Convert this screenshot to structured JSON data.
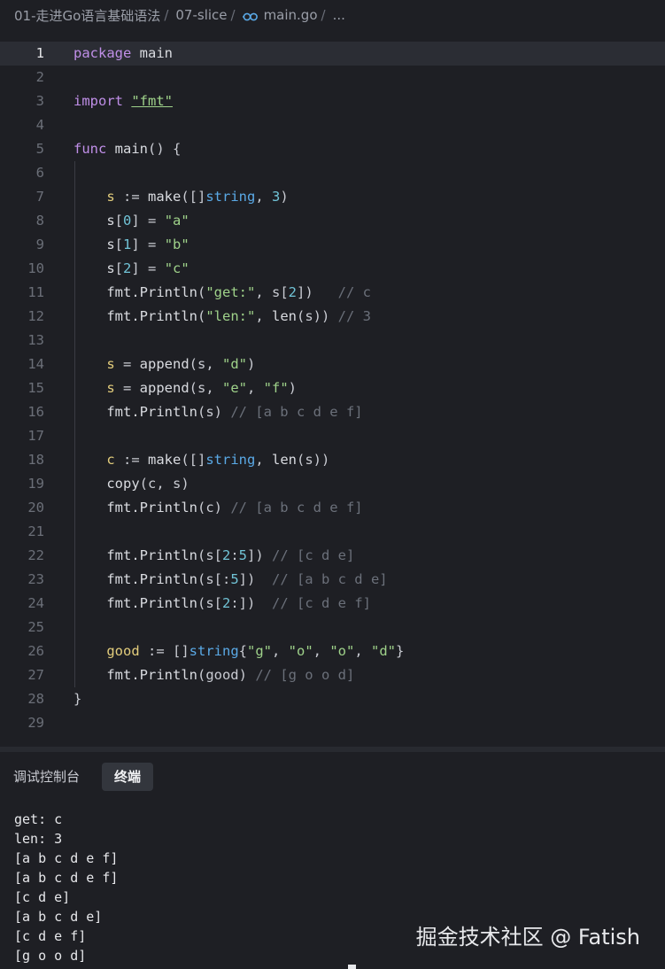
{
  "breadcrumb": {
    "items": [
      "01-走进Go语言基础语法",
      "07-slice",
      "main.go",
      "..."
    ],
    "separator": "/"
  },
  "editor": {
    "active_line": 1,
    "lines": [
      [
        [
          "kw",
          "package"
        ],
        [
          "p",
          " "
        ],
        [
          "pkg",
          "main"
        ]
      ],
      [],
      [
        [
          "kw",
          "import"
        ],
        [
          "p",
          " "
        ],
        [
          "strul",
          "\"fmt\""
        ]
      ],
      [],
      [
        [
          "kw",
          "func"
        ],
        [
          "p",
          " "
        ],
        [
          "fn",
          "main"
        ],
        [
          "p",
          "() {"
        ]
      ],
      [],
      [
        [
          "p",
          "    "
        ],
        [
          "var",
          "s"
        ],
        [
          "p",
          " := "
        ],
        [
          "fn",
          "make"
        ],
        [
          "p",
          "([]"
        ],
        [
          "type",
          "string"
        ],
        [
          "p",
          ", "
        ],
        [
          "num",
          "3"
        ],
        [
          "p",
          ")"
        ]
      ],
      [
        [
          "p",
          "    "
        ],
        [
          "fn",
          "s"
        ],
        [
          "p",
          "["
        ],
        [
          "num",
          "0"
        ],
        [
          "p",
          "] = "
        ],
        [
          "str",
          "\"a\""
        ]
      ],
      [
        [
          "p",
          "    "
        ],
        [
          "fn",
          "s"
        ],
        [
          "p",
          "["
        ],
        [
          "num",
          "1"
        ],
        [
          "p",
          "] = "
        ],
        [
          "str",
          "\"b\""
        ]
      ],
      [
        [
          "p",
          "    "
        ],
        [
          "fn",
          "s"
        ],
        [
          "p",
          "["
        ],
        [
          "num",
          "2"
        ],
        [
          "p",
          "] = "
        ],
        [
          "str",
          "\"c\""
        ]
      ],
      [
        [
          "p",
          "    "
        ],
        [
          "fn",
          "fmt.Println"
        ],
        [
          "p",
          "("
        ],
        [
          "str",
          "\"get:\""
        ],
        [
          "p",
          ", s["
        ],
        [
          "num",
          "2"
        ],
        [
          "p",
          "])   "
        ],
        [
          "cm",
          "// c"
        ]
      ],
      [
        [
          "p",
          "    "
        ],
        [
          "fn",
          "fmt.Println"
        ],
        [
          "p",
          "("
        ],
        [
          "str",
          "\"len:\""
        ],
        [
          "p",
          ", "
        ],
        [
          "fn",
          "len"
        ],
        [
          "p",
          "(s)) "
        ],
        [
          "cm",
          "// 3"
        ]
      ],
      [],
      [
        [
          "p",
          "    "
        ],
        [
          "var",
          "s"
        ],
        [
          "p",
          " = "
        ],
        [
          "fn",
          "append"
        ],
        [
          "p",
          "(s, "
        ],
        [
          "str",
          "\"d\""
        ],
        [
          "p",
          ")"
        ]
      ],
      [
        [
          "p",
          "    "
        ],
        [
          "var",
          "s"
        ],
        [
          "p",
          " = "
        ],
        [
          "fn",
          "append"
        ],
        [
          "p",
          "(s, "
        ],
        [
          "str",
          "\"e\""
        ],
        [
          "p",
          ", "
        ],
        [
          "str",
          "\"f\""
        ],
        [
          "p",
          ")"
        ]
      ],
      [
        [
          "p",
          "    "
        ],
        [
          "fn",
          "fmt.Println"
        ],
        [
          "p",
          "(s) "
        ],
        [
          "cm",
          "// [a b c d e f]"
        ]
      ],
      [],
      [
        [
          "p",
          "    "
        ],
        [
          "var",
          "c"
        ],
        [
          "p",
          " := "
        ],
        [
          "fn",
          "make"
        ],
        [
          "p",
          "([]"
        ],
        [
          "type",
          "string"
        ],
        [
          "p",
          ", "
        ],
        [
          "fn",
          "len"
        ],
        [
          "p",
          "(s))"
        ]
      ],
      [
        [
          "p",
          "    "
        ],
        [
          "fn",
          "copy"
        ],
        [
          "p",
          "(c, s)"
        ]
      ],
      [
        [
          "p",
          "    "
        ],
        [
          "fn",
          "fmt.Println"
        ],
        [
          "p",
          "(c) "
        ],
        [
          "cm",
          "// [a b c d e f]"
        ]
      ],
      [],
      [
        [
          "p",
          "    "
        ],
        [
          "fn",
          "fmt.Println"
        ],
        [
          "p",
          "(s["
        ],
        [
          "num",
          "2"
        ],
        [
          "p",
          ":"
        ],
        [
          "num",
          "5"
        ],
        [
          "p",
          "]) "
        ],
        [
          "cm",
          "// [c d e]"
        ]
      ],
      [
        [
          "p",
          "    "
        ],
        [
          "fn",
          "fmt.Println"
        ],
        [
          "p",
          "(s[:"
        ],
        [
          "num",
          "5"
        ],
        [
          "p",
          "])  "
        ],
        [
          "cm",
          "// [a b c d e]"
        ]
      ],
      [
        [
          "p",
          "    "
        ],
        [
          "fn",
          "fmt.Println"
        ],
        [
          "p",
          "(s["
        ],
        [
          "num",
          "2"
        ],
        [
          "p",
          ":])  "
        ],
        [
          "cm",
          "// [c d e f]"
        ]
      ],
      [],
      [
        [
          "p",
          "    "
        ],
        [
          "var",
          "good"
        ],
        [
          "p",
          " := []"
        ],
        [
          "type",
          "string"
        ],
        [
          "p",
          "{"
        ],
        [
          "str",
          "\"g\""
        ],
        [
          "p",
          ", "
        ],
        [
          "str",
          "\"o\""
        ],
        [
          "p",
          ", "
        ],
        [
          "str",
          "\"o\""
        ],
        [
          "p",
          ", "
        ],
        [
          "str",
          "\"d\""
        ],
        [
          "p",
          "}"
        ]
      ],
      [
        [
          "p",
          "    "
        ],
        [
          "fn",
          "fmt.Println"
        ],
        [
          "p",
          "(good) "
        ],
        [
          "cm",
          "// [g o o d]"
        ]
      ],
      [
        [
          "p",
          "}"
        ]
      ],
      []
    ]
  },
  "panel": {
    "tabs": {
      "debug_console": "调试控制台",
      "terminal": "终端"
    },
    "active_tab": "terminal",
    "output": [
      "get: c",
      "len: 3",
      "[a b c d e f]",
      "[a b c d e f]",
      "[c d e]",
      "[a b c d e]",
      "[c d e f]",
      "[g o o d]"
    ]
  },
  "watermark": {
    "text": "掘金技术社区 @ Fatish"
  },
  "colors": {
    "background": "#1e1f24",
    "keyword": "#c08fe8",
    "string": "#9fd28a",
    "number": "#71c4d7",
    "type": "#5aa9e6",
    "comment": "#6b707a",
    "variable": "#e3cd7c"
  },
  "icons": {
    "file_type": "go-file-icon"
  }
}
